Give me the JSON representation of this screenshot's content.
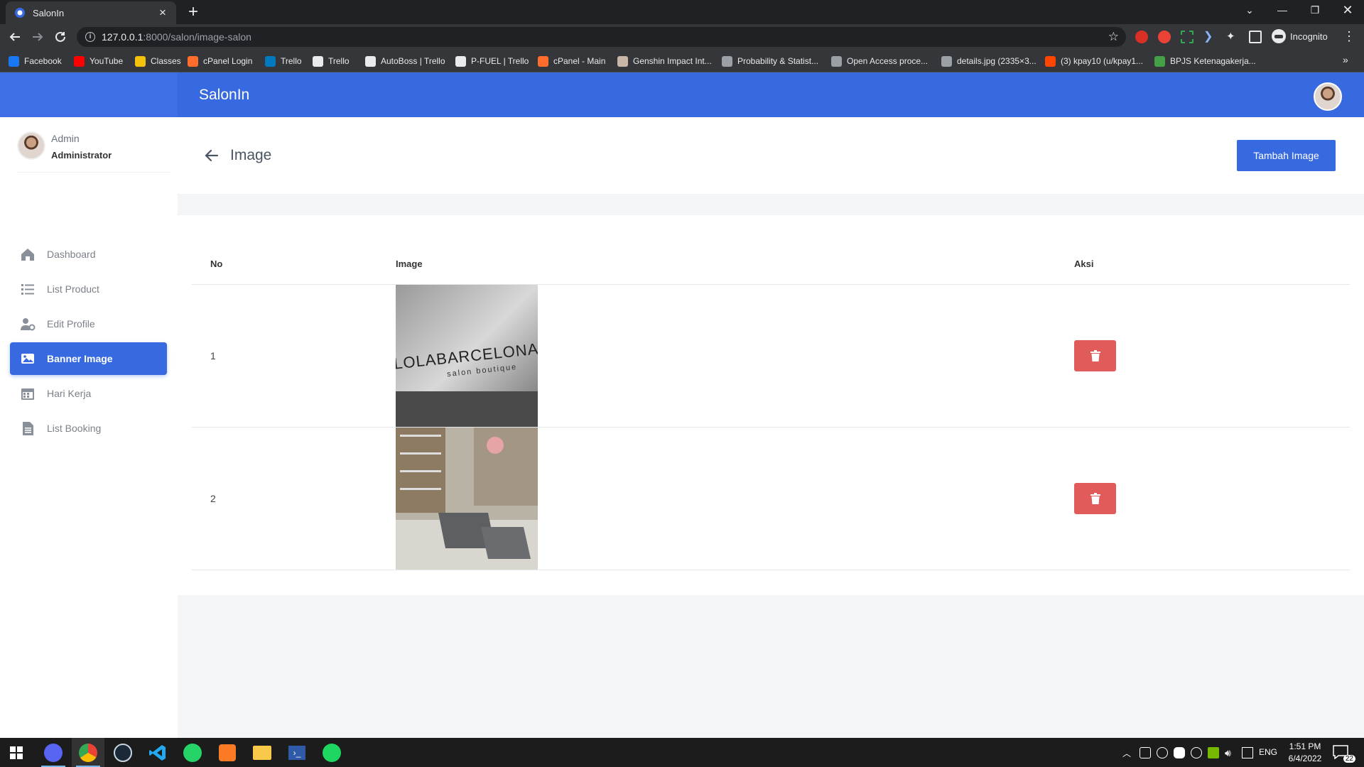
{
  "browser": {
    "tab_title": "SalonIn",
    "url_host": "127.0.0.1",
    "url_path": ":8000/salon/image-salon",
    "profile_label": "Incognito",
    "bookmarks": [
      {
        "label": "Facebook",
        "color": "#1877f2"
      },
      {
        "label": "YouTube",
        "color": "#ff0000"
      },
      {
        "label": "Classes",
        "color": "#f4c20d"
      },
      {
        "label": "cPanel Login",
        "color": "#ff6c2c"
      },
      {
        "label": "Trello",
        "color": "#0079bf"
      },
      {
        "label": "Trello",
        "color": "#e8eaed"
      },
      {
        "label": "AutoBoss | Trello",
        "color": "#e8eaed"
      },
      {
        "label": "P-FUEL | Trello",
        "color": "#e8eaed"
      },
      {
        "label": "cPanel - Main",
        "color": "#ff6c2c"
      },
      {
        "label": "Genshin Impact Int...",
        "color": "#c8b6a6"
      },
      {
        "label": "Probability & Statist...",
        "color": "#9aa0a6"
      },
      {
        "label": "Open Access proce...",
        "color": "#9aa0a6"
      },
      {
        "label": "details.jpg (2335×3...",
        "color": "#9aa0a6"
      },
      {
        "label": "(3) kpay10 (u/kpay1...",
        "color": "#ff4500"
      },
      {
        "label": "BPJS Ketenagakerja...",
        "color": "#43a047"
      }
    ]
  },
  "app": {
    "brand": "SalonIn",
    "user_name": "Admin",
    "user_role": "Administrator",
    "menu": [
      {
        "label": "Dashboard",
        "icon": "home-icon"
      },
      {
        "label": "List Product",
        "icon": "list-icon"
      },
      {
        "label": "Edit Profile",
        "icon": "user-gear-icon"
      },
      {
        "label": "Banner Image",
        "icon": "image-icon",
        "active": true
      },
      {
        "label": "Hari Kerja",
        "icon": "calendar-icon"
      },
      {
        "label": "List Booking",
        "icon": "document-icon"
      }
    ],
    "page_title": "Image",
    "add_button": "Tambah Image",
    "table": {
      "headers": {
        "no": "No",
        "image": "Image",
        "action": "Aksi"
      },
      "rows": [
        {
          "no": "1",
          "image": "LOLABARCELONA salon boutique sign"
        },
        {
          "no": "2",
          "image": "salon interior with chairs and mirrors"
        }
      ]
    },
    "accent_color": "#3769e0",
    "danger_color": "#e25b5b"
  },
  "taskbar": {
    "time": "1:51 PM",
    "date": "6/4/2022",
    "language": "ENG",
    "notifications": "22"
  }
}
